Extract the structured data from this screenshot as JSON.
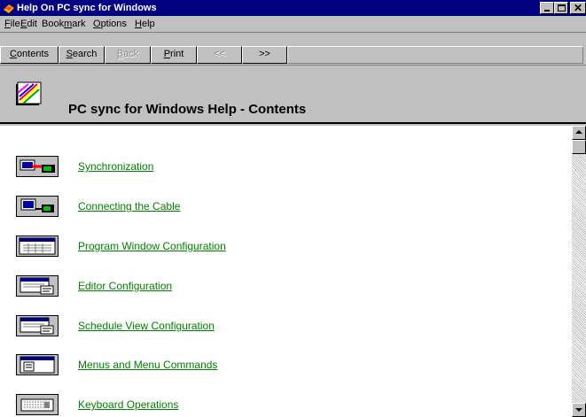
{
  "window": {
    "title": "Help On PC sync for Windows",
    "colors": {
      "title_bar": "#000080",
      "link": "#008000",
      "content_bg": "#ffffff",
      "chrome": "#c0c0c0"
    }
  },
  "menu": {
    "file": {
      "mnemonic": "F",
      "rest": "ile"
    },
    "edit": {
      "mnemonic": "E",
      "rest": "dit"
    },
    "bookmark": {
      "pre": "Book",
      "mnemonic": "m",
      "rest": "ark"
    },
    "options": {
      "mnemonic": "O",
      "rest": "ptions"
    },
    "help": {
      "mnemonic": "H",
      "rest": "elp"
    }
  },
  "buttons": {
    "contents": {
      "mnemonic": "C",
      "rest": "ontents"
    },
    "search": {
      "mnemonic": "S",
      "rest": "earch"
    },
    "back": {
      "mnemonic": "B",
      "rest": "ack"
    },
    "print": {
      "mnemonic": "P",
      "rest": "rint"
    },
    "prev": {
      "label": "<<"
    },
    "next": {
      "label": ">>"
    }
  },
  "header": {
    "icon": "help-book-icon",
    "title": "PC sync for Windows Help - Contents"
  },
  "topics": [
    {
      "label": "Synchronization",
      "icon": "synchronization-icon"
    },
    {
      "label": "Connecting the Cable",
      "icon": "cable-connection-icon"
    },
    {
      "label": "Program Window Configuration",
      "icon": "program-window-icon"
    },
    {
      "label": "Editor Configuration",
      "icon": "editor-window-icon"
    },
    {
      "label": "Schedule View Configuration",
      "icon": "schedule-window-icon"
    },
    {
      "label": "Menus and Menu Commands",
      "icon": "menu-window-icon"
    },
    {
      "label": "Keyboard Operations",
      "icon": "keyboard-icon"
    }
  ]
}
